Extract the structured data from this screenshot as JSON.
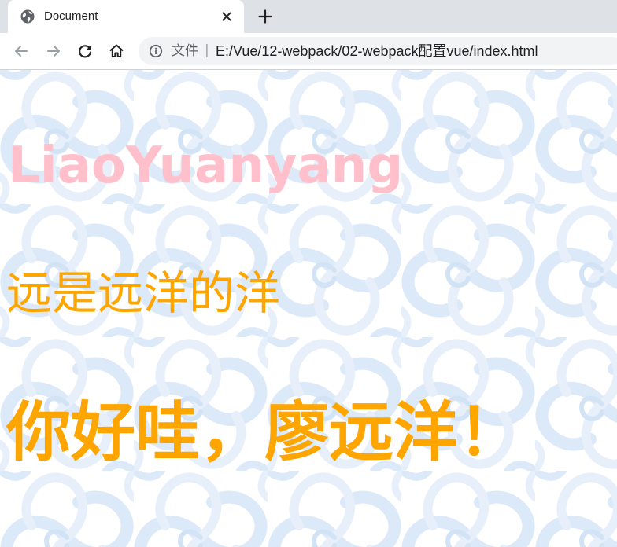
{
  "browser": {
    "tab": {
      "title": "Document",
      "favicon": "globe-icon"
    },
    "toolbar": {
      "security_label": "文件",
      "separator": "|",
      "url": "E:/Vue/12-webpack/02-webpack配置vue/index.html"
    }
  },
  "page": {
    "heading_1": "LiaoYuanyang",
    "heading_2": "远是远洋的洋",
    "heading_3": "你好哇，廖远洋！",
    "colors": {
      "heading_1": "#ffc0cb",
      "heading_2": "#ffa500",
      "heading_3": "#ffa500",
      "background_pattern": "#dce9f8"
    }
  }
}
